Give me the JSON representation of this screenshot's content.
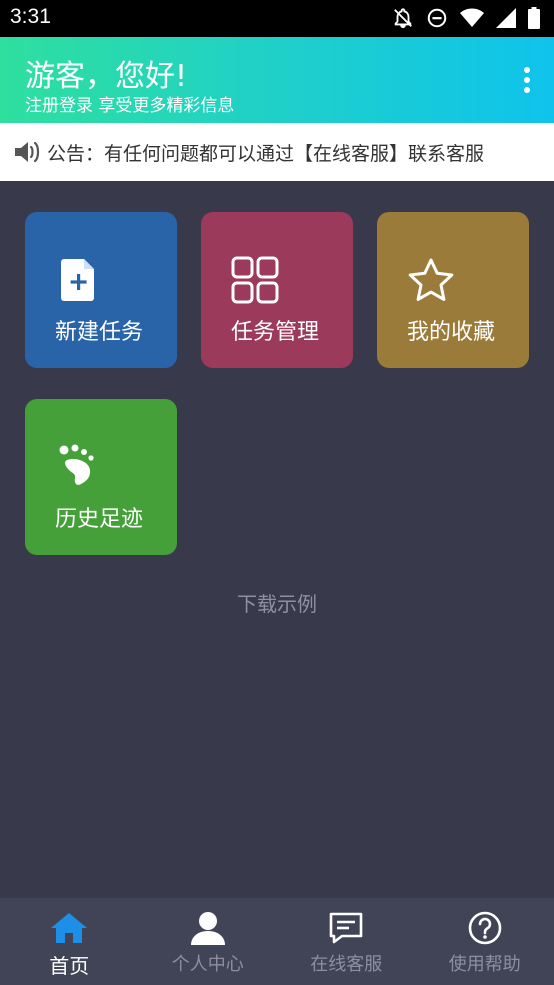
{
  "status_bar": {
    "time": "3:31"
  },
  "header": {
    "greeting": "游客，您好!",
    "subtitle": "注册登录 享受更多精彩信息"
  },
  "notice": {
    "text": "公告：有任何问题都可以通过【在线客服】联系客服"
  },
  "tiles": [
    {
      "label": "新建任务",
      "icon": "new-file-icon",
      "color": "#2a64a8"
    },
    {
      "label": "任务管理",
      "icon": "grid-icon",
      "color": "#9b3a5a"
    },
    {
      "label": "我的收藏",
      "icon": "star-icon",
      "color": "#9a7b3a"
    },
    {
      "label": "历史足迹",
      "icon": "footprint-icon",
      "color": "#45a03a"
    }
  ],
  "download_example": "下载示例",
  "bottom_nav": [
    {
      "label": "首页",
      "icon": "home-icon",
      "active": true
    },
    {
      "label": "个人中心",
      "icon": "user-icon",
      "active": false
    },
    {
      "label": "在线客服",
      "icon": "chat-icon",
      "active": false
    },
    {
      "label": "使用帮助",
      "icon": "help-icon",
      "active": false
    }
  ],
  "colors": {
    "header_gradient_start": "#2fdf9e",
    "header_gradient_end": "#0fc3ec",
    "background": "#383a4c",
    "nav_active": "#1e8fe6"
  }
}
